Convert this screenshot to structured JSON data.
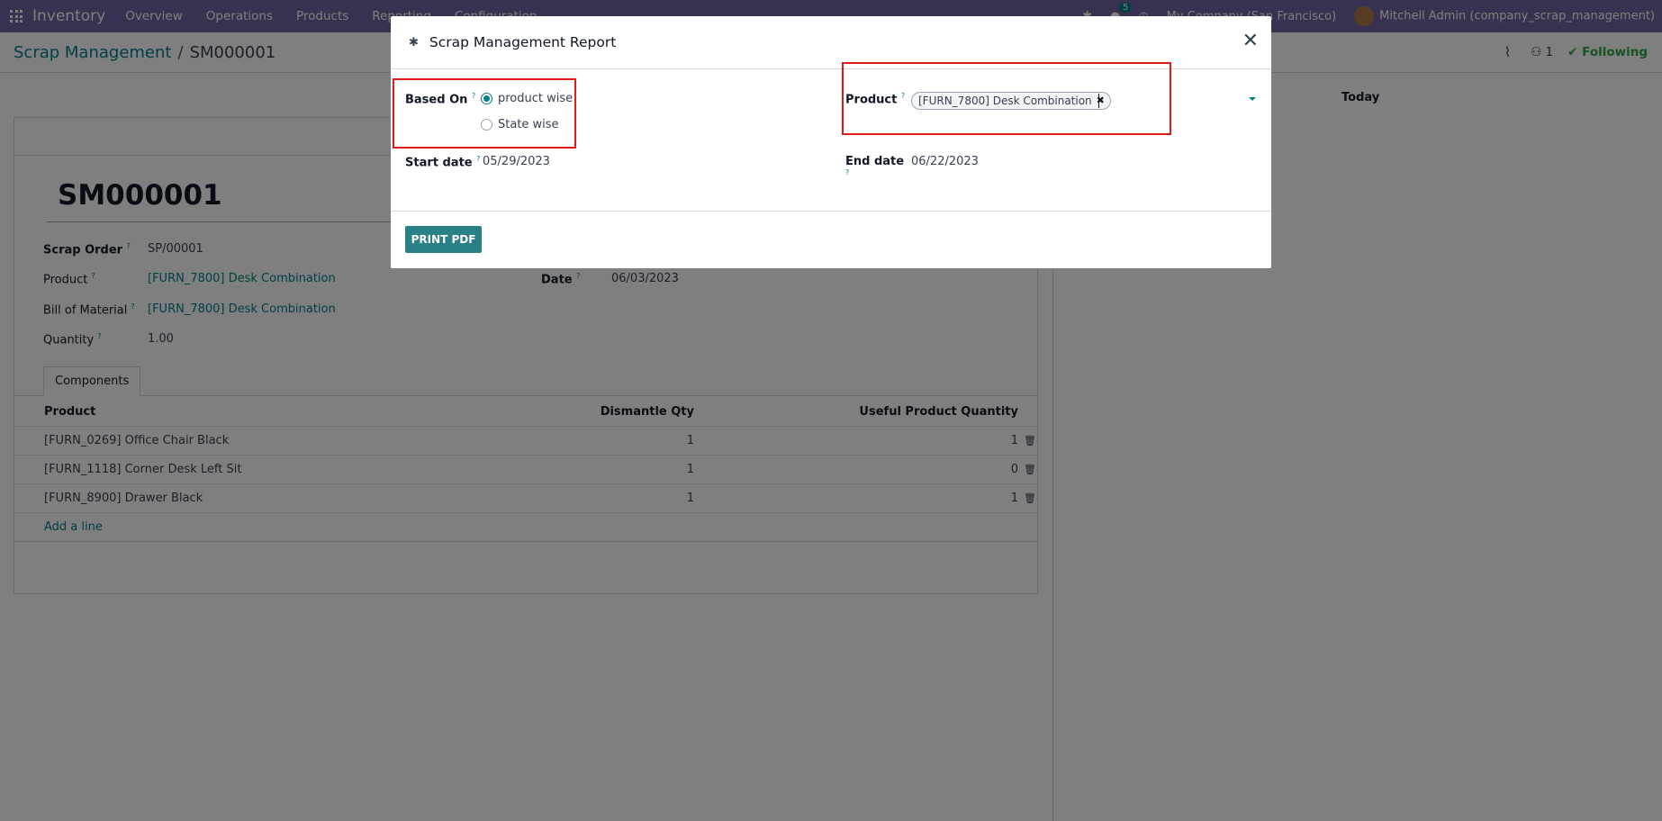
{
  "navbar": {
    "app_name": "Inventory",
    "menu": [
      "Overview",
      "Operations",
      "Products",
      "Reporting",
      "Configuration"
    ],
    "chat_count": "5",
    "company": "My Company (San Francisco)",
    "user": "Mitchell Admin (company_scrap_management)"
  },
  "breadcrumb": {
    "parent": "Scrap Management",
    "separator": "/",
    "current": "SM000001"
  },
  "control_panel": {
    "followers_count": "1",
    "following_label": "Following"
  },
  "record": {
    "title": "SM000001",
    "scrap_order_label": "Scrap Order",
    "scrap_order_value": "SP/00001",
    "product_label": "Product",
    "product_value": "[FURN_7800] Desk Combination",
    "bom_label": "Bill of Material",
    "bom_value": "[FURN_7800] Desk Combination",
    "quantity_label": "Quantity",
    "quantity_value": "1.00",
    "date_label": "Date",
    "date_value": "06/03/2023",
    "help_mark": "?"
  },
  "tabs": {
    "components": "Components"
  },
  "components_table": {
    "headers": [
      "Product",
      "Dismantle Qty",
      "Useful Product Quantity"
    ],
    "rows": [
      {
        "product": "[FURN_0269] Office Chair Black",
        "dismantle": "1",
        "useful": "1"
      },
      {
        "product": "[FURN_1118] Corner Desk Left Sit",
        "dismantle": "1",
        "useful": "0"
      },
      {
        "product": "[FURN_8900] Drawer Black",
        "dismantle": "1",
        "useful": "1"
      }
    ],
    "add_line": "Add a line"
  },
  "chatter": {
    "today_label": "Today"
  },
  "modal": {
    "title": "Scrap Management Report",
    "based_on_label": "Based On",
    "options": [
      "product wise",
      "State wise"
    ],
    "selected_option": "product wise",
    "product_label": "Product",
    "product_tag": "[FURN_7800] Desk Combination",
    "start_date_label": "Start date",
    "start_date_value": "05/29/2023",
    "end_date_label": "End date",
    "end_date_value": "06/22/2023",
    "print_button": "PRINT PDF"
  },
  "colors": {
    "navbar": "#71639e",
    "accent": "#017e84",
    "primary_button": "#2a8185",
    "highlight": "#e21a1a"
  }
}
